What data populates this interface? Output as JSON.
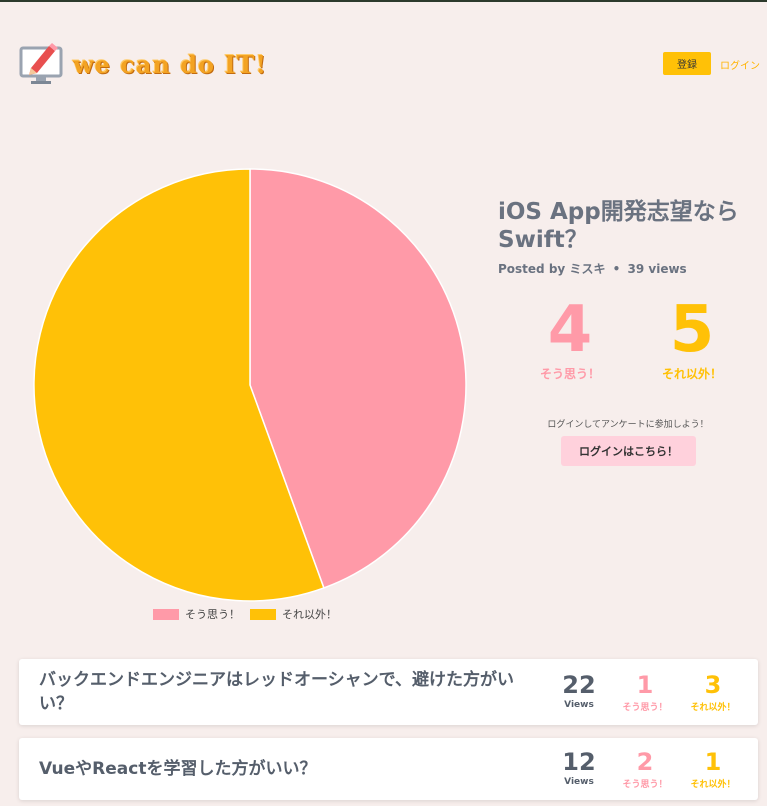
{
  "header": {
    "logo_text": "we can do IT!",
    "logo_icon": "monitor-pencil-icon",
    "register_label": "登録",
    "login_label": "ログイン"
  },
  "post": {
    "title": "iOS App開発志望ならSwift？",
    "meta_prefix": "Posted by",
    "author": "ミスキ",
    "separator": "•",
    "views": "39 views",
    "yes_count": "4",
    "yes_label": "そう思う！",
    "no_count": "5",
    "no_label": "それ以外！",
    "login_hint": "ログインしてアンケートに参加しよう！",
    "login_button": "ログインはこちら！"
  },
  "colors": {
    "yes": "#ff9aa8",
    "no": "#ffc107",
    "background": "#f7eeec"
  },
  "chart_data": {
    "type": "pie",
    "categories": [
      "そう思う！",
      "それ以外！"
    ],
    "values": [
      4,
      5
    ],
    "colors": [
      "#ff9aa8",
      "#ffc107"
    ],
    "legend": "bottom"
  },
  "list": [
    {
      "title": "バックエンドエンジニアはレッドオーシャンで、避けた方がいい？",
      "views": "22",
      "views_label": "Views",
      "yes": "1",
      "yes_label": "そう思う！",
      "no": "3",
      "no_label": "それ以外！"
    },
    {
      "title": "VueやReactを学習した方がいい？",
      "views": "12",
      "views_label": "Views",
      "yes": "2",
      "yes_label": "そう思う！",
      "no": "1",
      "no_label": "それ以外！"
    }
  ]
}
